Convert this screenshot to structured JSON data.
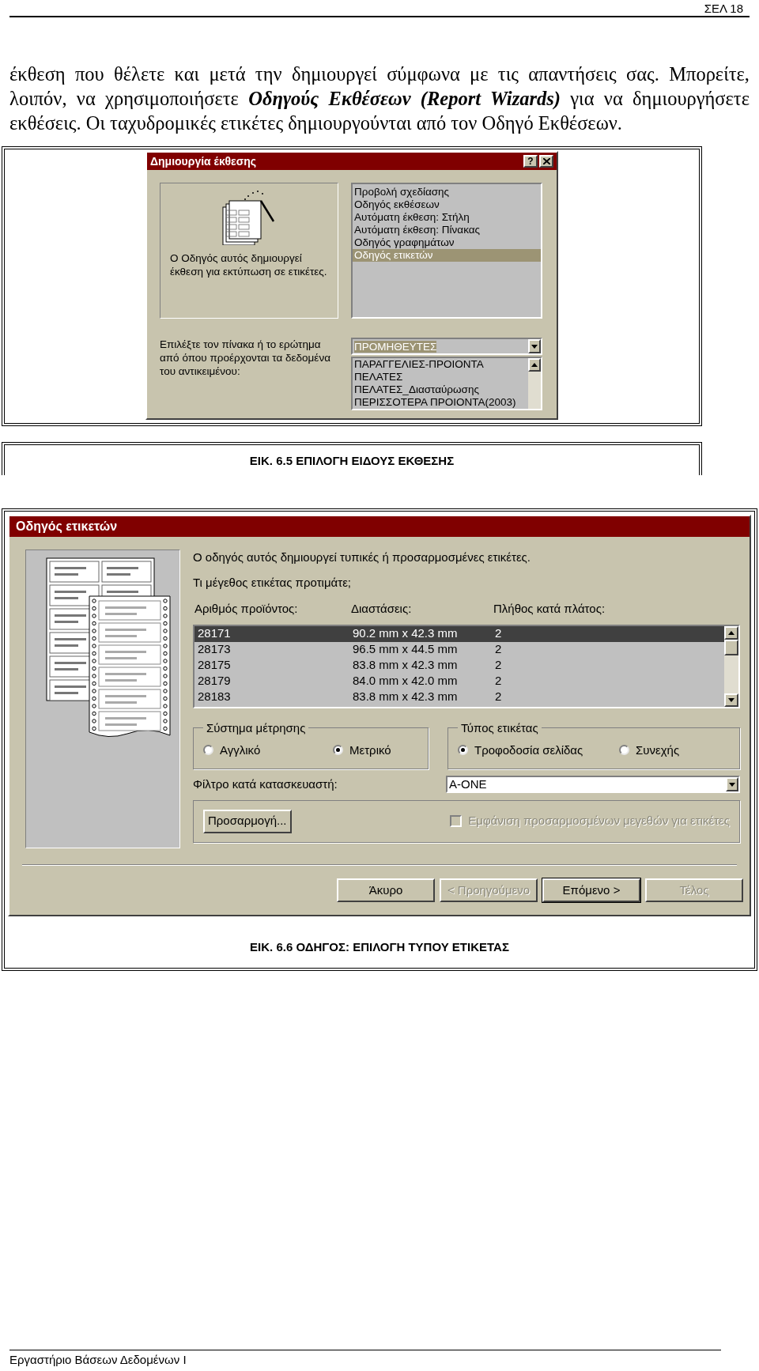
{
  "page_header": {
    "page_number": "ΣΕΛ 18"
  },
  "paragraph": {
    "parts": [
      {
        "text": "έκθεση που θέλετε και μετά την δημιουργεί σύμφωνα με τις απαντήσεις σας. Μπορείτε, λοιπόν, να χρησιμοποιήσετε ",
        "emphasis": false
      },
      {
        "text": "Οδηγούς Εκθέσεων (Report Wizards)",
        "emphasis": true
      },
      {
        "text": " για να δημιουργήσετε εκθέσεις. Οι ταχυδρομικές ετικέτες δημιουργούνται από τον Οδηγό Εκθέσεων.",
        "emphasis": false
      }
    ]
  },
  "figure_1": {
    "dialog": {
      "title": "Δημιουργία έκθεσης",
      "help_button": "?",
      "description": "Ο Οδηγός αυτός δημιουργεί έκθεση για εκτύπωση σε ετικέτες.",
      "report_types": [
        {
          "label": "Προβολή σχεδίασης",
          "selected": false
        },
        {
          "label": "Οδηγός εκθέσεων",
          "selected": false
        },
        {
          "label": "Αυτόματη έκθεση: Στήλη",
          "selected": false
        },
        {
          "label": "Αυτόματη έκθεση: Πίνακας",
          "selected": false
        },
        {
          "label": "Οδηγός γραφημάτων",
          "selected": false
        },
        {
          "label": "Οδηγός ετικετών",
          "selected": true
        }
      ],
      "source_label": "Επιλέξτε τον πίνακα ή το ερώτημα από όπου προέρχονται τα δεδομένα του αντικειμένου:",
      "source_value": "ΠΡΟΜΗΘΕΥΤΕΣ",
      "source_options": [
        "ΠΑΡΑΓΓΕΛΙΕΣ-ΠΡΟΙΟΝΤΑ",
        "ΠΕΛΑΤΕΣ",
        "ΠΕΛΑΤΕΣ_Διασταύρωσης",
        "ΠΕΡΙΣΣΟΤΕΡΑ ΠΡΟΙΟΝΤΑ(2003)"
      ]
    },
    "caption": "ΕΙΚ. 6.5 ΕΠΙΛΟΓΗ ΕΙΔΟΥΣ ΕΚΘΕΣΗΣ"
  },
  "figure_2": {
    "dialog": {
      "title": "Οδηγός ετικετών",
      "intro": "Ο οδηγός αυτός δημιουργεί τυπικές ή προσαρμοσμένες ετικέτες.",
      "question": "Τι μέγεθος ετικέτας προτιμάτε;",
      "columns": [
        "Αριθμός προϊόντος:",
        "Διαστάσεις:",
        "Πλήθος κατά πλάτος:"
      ],
      "rows": [
        {
          "cells": [
            "28171",
            "90.2 mm x 42.3 mm",
            "2"
          ],
          "selected": true
        },
        {
          "cells": [
            "28173",
            "96.5 mm x 44.5 mm",
            "2"
          ],
          "selected": false
        },
        {
          "cells": [
            "28175",
            "83.8 mm x 42.3 mm",
            "2"
          ],
          "selected": false
        },
        {
          "cells": [
            "28179",
            "84.0 mm x 42.0 mm",
            "2"
          ],
          "selected": false
        },
        {
          "cells": [
            "28183",
            "83.8 mm x 42.3 mm",
            "2"
          ],
          "selected": false
        }
      ],
      "groups": [
        {
          "title": "Σύστημα μέτρησης",
          "options": [
            {
              "label": "Αγγλικό",
              "selected": false
            },
            {
              "label": "Μετρικό",
              "selected": true
            }
          ]
        },
        {
          "title": "Τύπος ετικέτας",
          "options": [
            {
              "label": "Τροφοδοσία σελίδας",
              "selected": true
            },
            {
              "label": "Συνεχής",
              "selected": false
            }
          ]
        }
      ],
      "filter_label": "Φίλτρο κατά κατασκευαστή:",
      "filter_value": "A-ONE",
      "customize_button": "Προσαρμογή...",
      "custom_sizes_checkbox": {
        "label": "Εμφάνιση προσαρμοσμένων μεγεθών για ετικέτες",
        "checked": false,
        "disabled": true
      },
      "buttons": [
        {
          "label": "Άκυρο",
          "disabled": false,
          "default": false
        },
        {
          "label": "< Προηγούμενο",
          "disabled": true,
          "default": false
        },
        {
          "label": "Επόμενο >",
          "disabled": false,
          "default": true
        },
        {
          "label": "Τέλος",
          "disabled": true,
          "default": false
        }
      ]
    },
    "caption": "ΕΙΚ. 6.6 ΟΔΗΓΟΣ: ΕΠΙΛΟΓΗ ΤΥΠΟΥ ΕΤΙΚΕΤΑΣ"
  },
  "footer": {
    "text": "Εργαστήριο Βάσεων Δεδομένων Ι"
  }
}
